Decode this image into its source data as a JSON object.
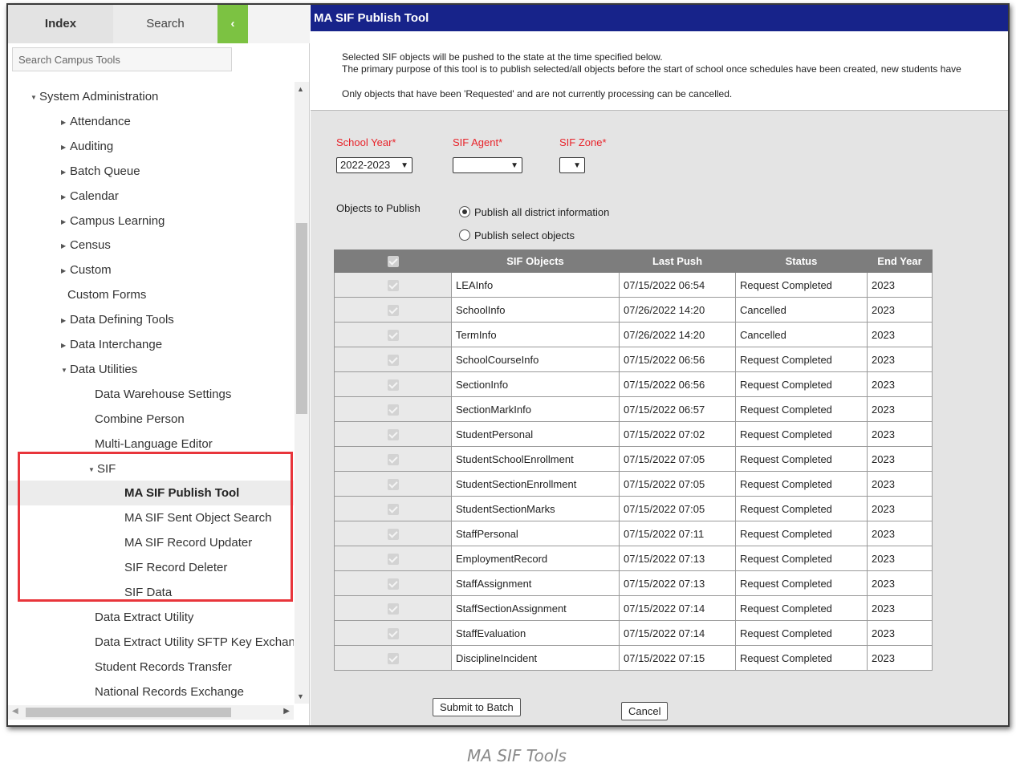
{
  "sidebar": {
    "tabs": {
      "index": "Index",
      "search": "Search",
      "collapse": "‹"
    },
    "search_placeholder": "Search Campus Tools",
    "tree": [
      {
        "label": "System Administration",
        "caret": "▼",
        "indent": 0,
        "name": "tree-item-system-administration"
      },
      {
        "label": "Attendance",
        "caret": "▶",
        "indent": 1,
        "name": "tree-item-attendance"
      },
      {
        "label": "Auditing",
        "caret": "▶",
        "indent": 1,
        "name": "tree-item-auditing"
      },
      {
        "label": "Batch Queue",
        "caret": "▶",
        "indent": 1,
        "name": "tree-item-batch-queue"
      },
      {
        "label": "Calendar",
        "caret": "▶",
        "indent": 1,
        "name": "tree-item-calendar"
      },
      {
        "label": "Campus Learning",
        "caret": "▶",
        "indent": 1,
        "name": "tree-item-campus-learning"
      },
      {
        "label": "Census",
        "caret": "▶",
        "indent": 1,
        "name": "tree-item-census"
      },
      {
        "label": "Custom",
        "caret": "▶",
        "indent": 1,
        "name": "tree-item-custom"
      },
      {
        "label": "Custom Forms",
        "caret": "",
        "indent": 1,
        "name": "tree-item-custom-forms"
      },
      {
        "label": "Data Defining Tools",
        "caret": "▶",
        "indent": 1,
        "name": "tree-item-data-defining-tools"
      },
      {
        "label": "Data Interchange",
        "caret": "▶",
        "indent": 1,
        "name": "tree-item-data-interchange"
      },
      {
        "label": "Data Utilities",
        "caret": "▼",
        "indent": 1,
        "name": "tree-item-data-utilities"
      },
      {
        "label": "Data Warehouse Settings",
        "caret": "",
        "indent": 2,
        "name": "tree-item-data-warehouse-settings"
      },
      {
        "label": "Combine Person",
        "caret": "",
        "indent": 2,
        "name": "tree-item-combine-person"
      },
      {
        "label": "Multi-Language Editor",
        "caret": "",
        "indent": 2,
        "name": "tree-item-multi-language-editor"
      },
      {
        "label": "SIF",
        "caret": "▼",
        "indent": 2,
        "name": "tree-item-sif"
      },
      {
        "label": "MA SIF Publish Tool",
        "caret": "",
        "indent": 3,
        "name": "tree-item-ma-sif-publish-tool",
        "selected": true
      },
      {
        "label": "MA SIF Sent Object Search",
        "caret": "",
        "indent": 3,
        "name": "tree-item-ma-sif-sent-object-search"
      },
      {
        "label": "MA SIF Record Updater",
        "caret": "",
        "indent": 3,
        "name": "tree-item-ma-sif-record-updater"
      },
      {
        "label": "SIF Record Deleter",
        "caret": "",
        "indent": 3,
        "name": "tree-item-sif-record-deleter"
      },
      {
        "label": "SIF Data",
        "caret": "",
        "indent": 3,
        "name": "tree-item-sif-data"
      },
      {
        "label": "Data Extract Utility",
        "caret": "",
        "indent": 2,
        "name": "tree-item-data-extract-utility"
      },
      {
        "label": "Data Extract Utility SFTP Key Exchange",
        "caret": "",
        "indent": 2,
        "name": "tree-item-data-extract-utility-sftp"
      },
      {
        "label": "Student Records Transfer",
        "caret": "",
        "indent": 2,
        "name": "tree-item-student-records-transfer"
      },
      {
        "label": "National Records Exchange",
        "caret": "",
        "indent": 2,
        "name": "tree-item-national-records-exchange"
      }
    ]
  },
  "main": {
    "title": "MA SIF Publish Tool",
    "info": {
      "line1": "Selected SIF objects will be pushed to the state at the time specified below.",
      "line2": "The primary purpose of this tool is to publish selected/all objects before the start of school once schedules have been created, new students have",
      "line3": "Only objects that have been 'Requested' and are not currently processing can be cancelled."
    },
    "fields": {
      "school_year_label": "School Year*",
      "school_year_value": "2022-2023",
      "sif_agent_label": "SIF Agent*",
      "sif_agent_value": "",
      "sif_zone_label": "SIF Zone*",
      "sif_zone_value": ""
    },
    "objects_label": "Objects to Publish",
    "radio_all": "Publish all district information",
    "radio_select": "Publish select objects",
    "table": {
      "headers": [
        "SIF Objects",
        "Last Push",
        "Status",
        "End Year"
      ],
      "rows": [
        [
          "LEAInfo",
          "07/15/2022 06:54",
          "Request Completed",
          "2023"
        ],
        [
          "SchoolInfo",
          "07/26/2022 14:20",
          "Cancelled",
          "2023"
        ],
        [
          "TermInfo",
          "07/26/2022 14:20",
          "Cancelled",
          "2023"
        ],
        [
          "SchoolCourseInfo",
          "07/15/2022 06:56",
          "Request Completed",
          "2023"
        ],
        [
          "SectionInfo",
          "07/15/2022 06:56",
          "Request Completed",
          "2023"
        ],
        [
          "SectionMarkInfo",
          "07/15/2022 06:57",
          "Request Completed",
          "2023"
        ],
        [
          "StudentPersonal",
          "07/15/2022 07:02",
          "Request Completed",
          "2023"
        ],
        [
          "StudentSchoolEnrollment",
          "07/15/2022 07:05",
          "Request Completed",
          "2023"
        ],
        [
          "StudentSectionEnrollment",
          "07/15/2022 07:05",
          "Request Completed",
          "2023"
        ],
        [
          "StudentSectionMarks",
          "07/15/2022 07:05",
          "Request Completed",
          "2023"
        ],
        [
          "StaffPersonal",
          "07/15/2022 07:11",
          "Request Completed",
          "2023"
        ],
        [
          "EmploymentRecord",
          "07/15/2022 07:13",
          "Request Completed",
          "2023"
        ],
        [
          "StaffAssignment",
          "07/15/2022 07:13",
          "Request Completed",
          "2023"
        ],
        [
          "StaffSectionAssignment",
          "07/15/2022 07:14",
          "Request Completed",
          "2023"
        ],
        [
          "StaffEvaluation",
          "07/15/2022 07:14",
          "Request Completed",
          "2023"
        ],
        [
          "DisciplineIncident",
          "07/15/2022 07:15",
          "Request Completed",
          "2023"
        ]
      ]
    },
    "buttons": {
      "submit": "Submit to Batch",
      "cancel": "Cancel"
    }
  },
  "caption": "MA SIF Tools",
  "colors": {
    "title_bar": "#17238a",
    "accent_green": "#7cc242",
    "required_label": "#e8232a",
    "highlight_box": "#e8353b"
  },
  "icons": {
    "collapse": "chevron-left-icon",
    "caret_expanded": "triangle-down-icon",
    "caret_collapsed": "triangle-right-icon",
    "select": "chevron-down-icon"
  }
}
